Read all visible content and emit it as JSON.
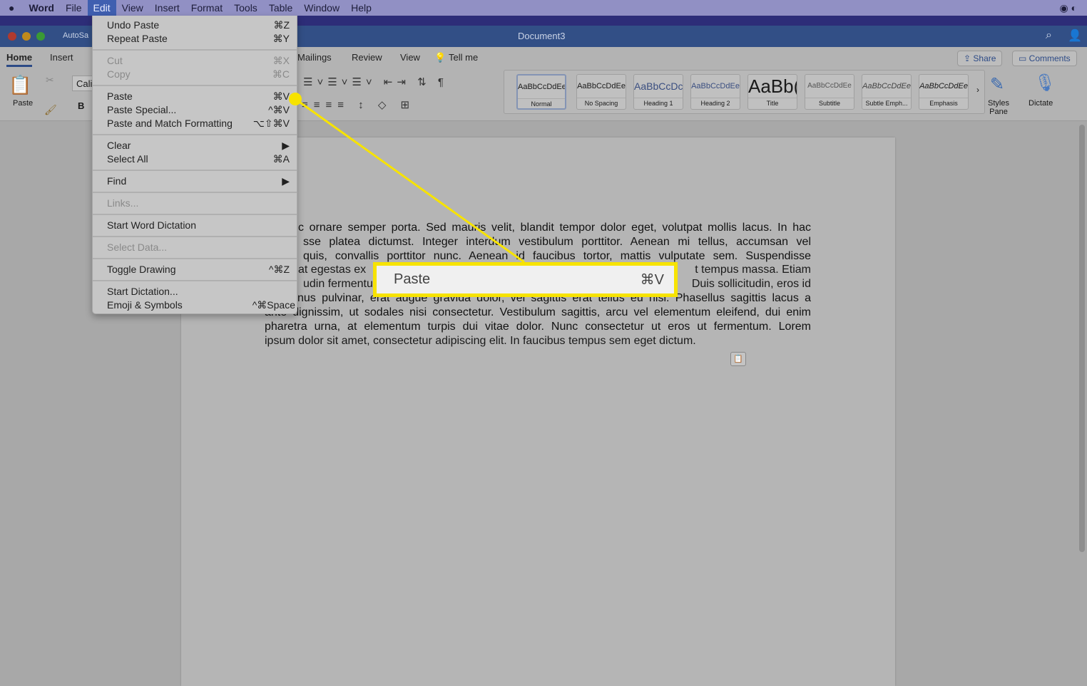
{
  "menubar": {
    "items": [
      "Word",
      "File",
      "Edit",
      "View",
      "Insert",
      "Format",
      "Tools",
      "Table",
      "Window",
      "Help"
    ],
    "active": "Edit"
  },
  "window": {
    "title": "Document3",
    "autosave": "AutoSa"
  },
  "ribbon": {
    "tabs": [
      "Home",
      "Insert",
      "Mailings",
      "Review",
      "View"
    ],
    "tell_me": "Tell me",
    "share": "Share",
    "comments": "Comments",
    "paste": "Paste",
    "font": "Cali",
    "bold": "B",
    "styles_pane": "Styles Pane",
    "dictate": "Dictate",
    "styles": [
      {
        "preview": "AaBbCcDdEe",
        "name": "Normal"
      },
      {
        "preview": "AaBbCcDdEe",
        "name": "No Spacing"
      },
      {
        "preview": "AaBbCcDc",
        "name": "Heading 1"
      },
      {
        "preview": "AaBbCcDdEe",
        "name": "Heading 2"
      },
      {
        "preview": "AaBb(",
        "name": "Title"
      },
      {
        "preview": "AaBbCcDdEe",
        "name": "Subtitle"
      },
      {
        "preview": "AaBbCcDdEe",
        "name": "Subtle Emph..."
      },
      {
        "preview": "AaBbCcDdEe",
        "name": "Emphasis"
      }
    ]
  },
  "edit_menu": {
    "items": [
      {
        "label": "Undo Paste",
        "shortcut": "⌘Z"
      },
      {
        "label": "Repeat Paste",
        "shortcut": "⌘Y"
      },
      {
        "label": "Cut",
        "shortcut": "⌘X",
        "disabled": true
      },
      {
        "label": "Copy",
        "shortcut": "⌘C",
        "disabled": true
      },
      {
        "label": "Paste",
        "shortcut": "⌘V"
      },
      {
        "label": "Paste Special...",
        "shortcut": "^⌘V"
      },
      {
        "label": "Paste and Match Formatting",
        "shortcut": "⌥⇧⌘V"
      },
      {
        "label": "Clear",
        "shortcut": "▶"
      },
      {
        "label": "Select All",
        "shortcut": "⌘A"
      },
      {
        "label": "Find",
        "shortcut": "▶"
      },
      {
        "label": "Links...",
        "shortcut": "",
        "disabled": true
      },
      {
        "label": "Start Word Dictation",
        "shortcut": ""
      },
      {
        "label": "Select Data...",
        "shortcut": "",
        "disabled": true
      },
      {
        "label": "Toggle Drawing",
        "shortcut": "^⌘Z"
      },
      {
        "label": "Start Dictation...",
        "shortcut": ""
      },
      {
        "label": "Emoji & Symbols",
        "shortcut": "^⌘Space"
      }
    ]
  },
  "callout": {
    "label": "Paste",
    "shortcut": "⌘V",
    "color": "#f7e300"
  },
  "document": {
    "lines": [
      "c ornare semper porta. Sed mauris velit, blandit tempor dolor eget, volutpat mollis lacus. In hac",
      "sse platea dictumst. Integer interdum vestibulum porttitor. Aenean mi tellus, accumsan vel",
      "quis, convallis porttitor nunc. Aenean id faucibus tortor, mattis vulputate sem. Suspendisse",
      "at egestas ex",
      "t tempus massa. Etiam",
      "udin fermentu",
      "Duis sollicitudin, eros id",
      "nus pulvinar, erat augue gravida dolor, vel sagittis erat tellus eu nisi. Phasellus sagittis lacus a",
      "ante dignissim, ut sodales nisi consectetur. Vestibulum sagittis, arcu vel elementum eleifend, dui enim",
      "pharetra urna, at elementum turpis dui vitae dolor. Nunc consectetur ut eros ut fermentum. Lorem",
      "ipsum dolor sit amet, consectetur adipiscing elit. In faucibus tempus sem eget dictum."
    ]
  }
}
